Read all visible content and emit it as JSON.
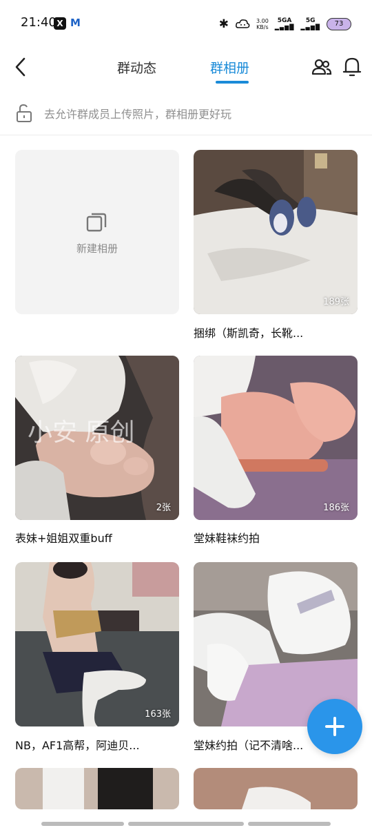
{
  "status_bar": {
    "time": "21:40",
    "app_x": "X",
    "app_m": "M",
    "net_speed_value": "3.00",
    "net_speed_unit": "KB/s",
    "signal1": "5GA",
    "signal2": "5G",
    "battery": "73"
  },
  "header": {
    "tab_dynamics": "群动态",
    "tab_album": "群相册"
  },
  "notice": {
    "text": "去允许群成员上传照片，群相册更好玩"
  },
  "new_album": {
    "label": "新建相册"
  },
  "albums": [
    {
      "title": "捆绑（斯凯奇，长靴...",
      "count": "189张"
    },
    {
      "title": "表妹+姐姐双重buff",
      "count": "2张",
      "watermark": "小安 原创"
    },
    {
      "title": "堂妹鞋袜约拍",
      "count": "186张"
    },
    {
      "title": "NB，AF1高帮，阿迪贝...",
      "count": "163张"
    },
    {
      "title": "堂妹约拍（记不清啥...",
      "count": ""
    }
  ],
  "colors": {
    "accent": "#1a8bd8",
    "fab": "#2a95ea"
  },
  "icons": {
    "back": "chevron-left-icon",
    "members": "group-members-icon",
    "bell": "bell-icon",
    "lock": "unlock-icon",
    "new_album": "copy-icon",
    "fab": "plus-icon"
  }
}
